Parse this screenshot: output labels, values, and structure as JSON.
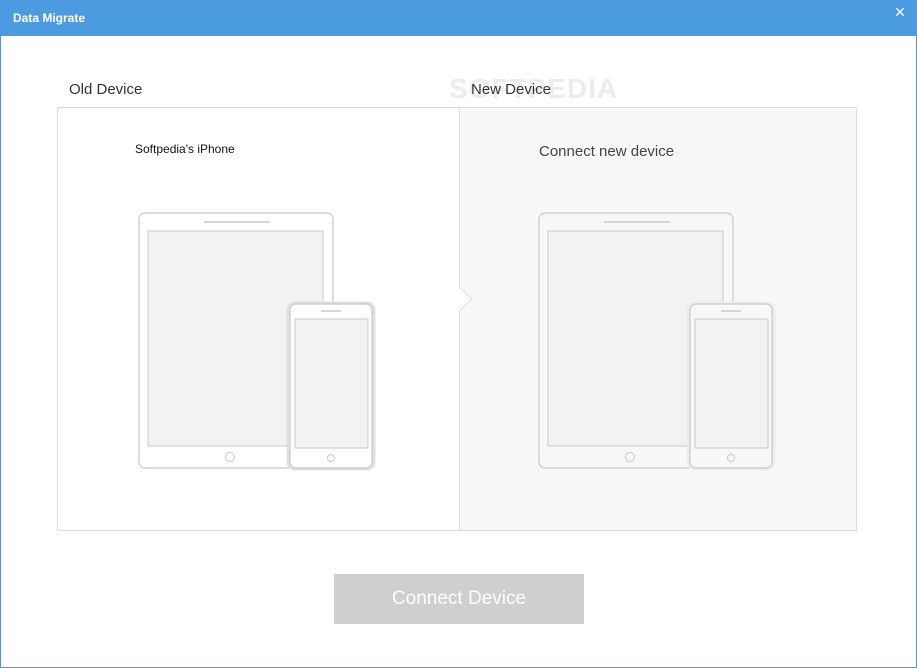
{
  "window": {
    "title": "Data Migrate",
    "close_glyph": "✕"
  },
  "watermark": "SOFTPEDIA",
  "old_device": {
    "label": "Old Device",
    "device_name": "Softpedia's iPhone"
  },
  "new_device": {
    "label": "New Device",
    "prompt": "Connect new device"
  },
  "actions": {
    "connect_label": "Connect Device"
  },
  "colors": {
    "titlebar": "#4a9be0",
    "button_disabled": "#cfcfcf",
    "panel_new_bg": "#f8f8f8"
  },
  "icons": [
    "close-icon",
    "tablet-icon",
    "phone-icon"
  ]
}
